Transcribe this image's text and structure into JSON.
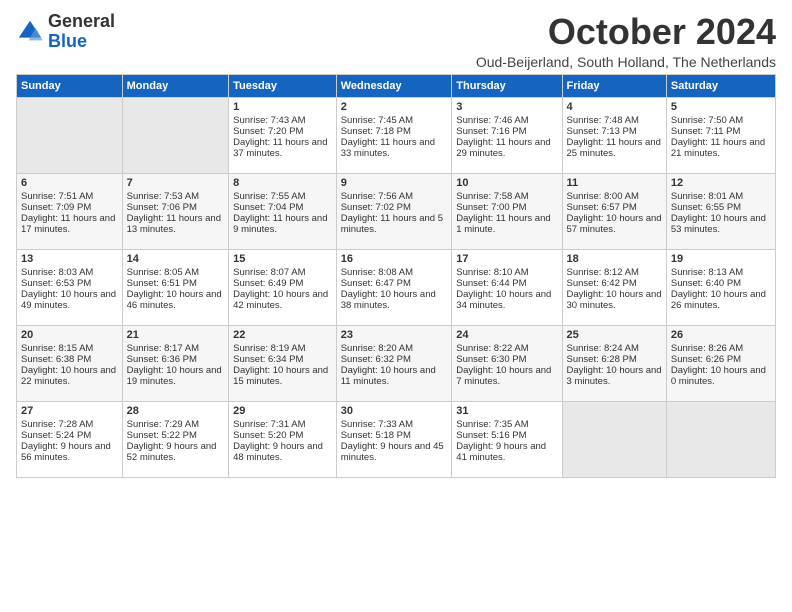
{
  "logo": {
    "general": "General",
    "blue": "Blue"
  },
  "title": "October 2024",
  "subtitle": "Oud-Beijerland, South Holland, The Netherlands",
  "days_header": [
    "Sunday",
    "Monday",
    "Tuesday",
    "Wednesday",
    "Thursday",
    "Friday",
    "Saturday"
  ],
  "weeks": [
    [
      {
        "day": "",
        "content": ""
      },
      {
        "day": "",
        "content": ""
      },
      {
        "day": "1",
        "sunrise": "Sunrise: 7:43 AM",
        "sunset": "Sunset: 7:20 PM",
        "daylight": "Daylight: 11 hours and 37 minutes."
      },
      {
        "day": "2",
        "sunrise": "Sunrise: 7:45 AM",
        "sunset": "Sunset: 7:18 PM",
        "daylight": "Daylight: 11 hours and 33 minutes."
      },
      {
        "day": "3",
        "sunrise": "Sunrise: 7:46 AM",
        "sunset": "Sunset: 7:16 PM",
        "daylight": "Daylight: 11 hours and 29 minutes."
      },
      {
        "day": "4",
        "sunrise": "Sunrise: 7:48 AM",
        "sunset": "Sunset: 7:13 PM",
        "daylight": "Daylight: 11 hours and 25 minutes."
      },
      {
        "day": "5",
        "sunrise": "Sunrise: 7:50 AM",
        "sunset": "Sunset: 7:11 PM",
        "daylight": "Daylight: 11 hours and 21 minutes."
      }
    ],
    [
      {
        "day": "6",
        "sunrise": "Sunrise: 7:51 AM",
        "sunset": "Sunset: 7:09 PM",
        "daylight": "Daylight: 11 hours and 17 minutes."
      },
      {
        "day": "7",
        "sunrise": "Sunrise: 7:53 AM",
        "sunset": "Sunset: 7:06 PM",
        "daylight": "Daylight: 11 hours and 13 minutes."
      },
      {
        "day": "8",
        "sunrise": "Sunrise: 7:55 AM",
        "sunset": "Sunset: 7:04 PM",
        "daylight": "Daylight: 11 hours and 9 minutes."
      },
      {
        "day": "9",
        "sunrise": "Sunrise: 7:56 AM",
        "sunset": "Sunset: 7:02 PM",
        "daylight": "Daylight: 11 hours and 5 minutes."
      },
      {
        "day": "10",
        "sunrise": "Sunrise: 7:58 AM",
        "sunset": "Sunset: 7:00 PM",
        "daylight": "Daylight: 11 hours and 1 minute."
      },
      {
        "day": "11",
        "sunrise": "Sunrise: 8:00 AM",
        "sunset": "Sunset: 6:57 PM",
        "daylight": "Daylight: 10 hours and 57 minutes."
      },
      {
        "day": "12",
        "sunrise": "Sunrise: 8:01 AM",
        "sunset": "Sunset: 6:55 PM",
        "daylight": "Daylight: 10 hours and 53 minutes."
      }
    ],
    [
      {
        "day": "13",
        "sunrise": "Sunrise: 8:03 AM",
        "sunset": "Sunset: 6:53 PM",
        "daylight": "Daylight: 10 hours and 49 minutes."
      },
      {
        "day": "14",
        "sunrise": "Sunrise: 8:05 AM",
        "sunset": "Sunset: 6:51 PM",
        "daylight": "Daylight: 10 hours and 46 minutes."
      },
      {
        "day": "15",
        "sunrise": "Sunrise: 8:07 AM",
        "sunset": "Sunset: 6:49 PM",
        "daylight": "Daylight: 10 hours and 42 minutes."
      },
      {
        "day": "16",
        "sunrise": "Sunrise: 8:08 AM",
        "sunset": "Sunset: 6:47 PM",
        "daylight": "Daylight: 10 hours and 38 minutes."
      },
      {
        "day": "17",
        "sunrise": "Sunrise: 8:10 AM",
        "sunset": "Sunset: 6:44 PM",
        "daylight": "Daylight: 10 hours and 34 minutes."
      },
      {
        "day": "18",
        "sunrise": "Sunrise: 8:12 AM",
        "sunset": "Sunset: 6:42 PM",
        "daylight": "Daylight: 10 hours and 30 minutes."
      },
      {
        "day": "19",
        "sunrise": "Sunrise: 8:13 AM",
        "sunset": "Sunset: 6:40 PM",
        "daylight": "Daylight: 10 hours and 26 minutes."
      }
    ],
    [
      {
        "day": "20",
        "sunrise": "Sunrise: 8:15 AM",
        "sunset": "Sunset: 6:38 PM",
        "daylight": "Daylight: 10 hours and 22 minutes."
      },
      {
        "day": "21",
        "sunrise": "Sunrise: 8:17 AM",
        "sunset": "Sunset: 6:36 PM",
        "daylight": "Daylight: 10 hours and 19 minutes."
      },
      {
        "day": "22",
        "sunrise": "Sunrise: 8:19 AM",
        "sunset": "Sunset: 6:34 PM",
        "daylight": "Daylight: 10 hours and 15 minutes."
      },
      {
        "day": "23",
        "sunrise": "Sunrise: 8:20 AM",
        "sunset": "Sunset: 6:32 PM",
        "daylight": "Daylight: 10 hours and 11 minutes."
      },
      {
        "day": "24",
        "sunrise": "Sunrise: 8:22 AM",
        "sunset": "Sunset: 6:30 PM",
        "daylight": "Daylight: 10 hours and 7 minutes."
      },
      {
        "day": "25",
        "sunrise": "Sunrise: 8:24 AM",
        "sunset": "Sunset: 6:28 PM",
        "daylight": "Daylight: 10 hours and 3 minutes."
      },
      {
        "day": "26",
        "sunrise": "Sunrise: 8:26 AM",
        "sunset": "Sunset: 6:26 PM",
        "daylight": "Daylight: 10 hours and 0 minutes."
      }
    ],
    [
      {
        "day": "27",
        "sunrise": "Sunrise: 7:28 AM",
        "sunset": "Sunset: 5:24 PM",
        "daylight": "Daylight: 9 hours and 56 minutes."
      },
      {
        "day": "28",
        "sunrise": "Sunrise: 7:29 AM",
        "sunset": "Sunset: 5:22 PM",
        "daylight": "Daylight: 9 hours and 52 minutes."
      },
      {
        "day": "29",
        "sunrise": "Sunrise: 7:31 AM",
        "sunset": "Sunset: 5:20 PM",
        "daylight": "Daylight: 9 hours and 48 minutes."
      },
      {
        "day": "30",
        "sunrise": "Sunrise: 7:33 AM",
        "sunset": "Sunset: 5:18 PM",
        "daylight": "Daylight: 9 hours and 45 minutes."
      },
      {
        "day": "31",
        "sunrise": "Sunrise: 7:35 AM",
        "sunset": "Sunset: 5:16 PM",
        "daylight": "Daylight: 9 hours and 41 minutes."
      },
      {
        "day": "",
        "content": ""
      },
      {
        "day": "",
        "content": ""
      }
    ]
  ]
}
